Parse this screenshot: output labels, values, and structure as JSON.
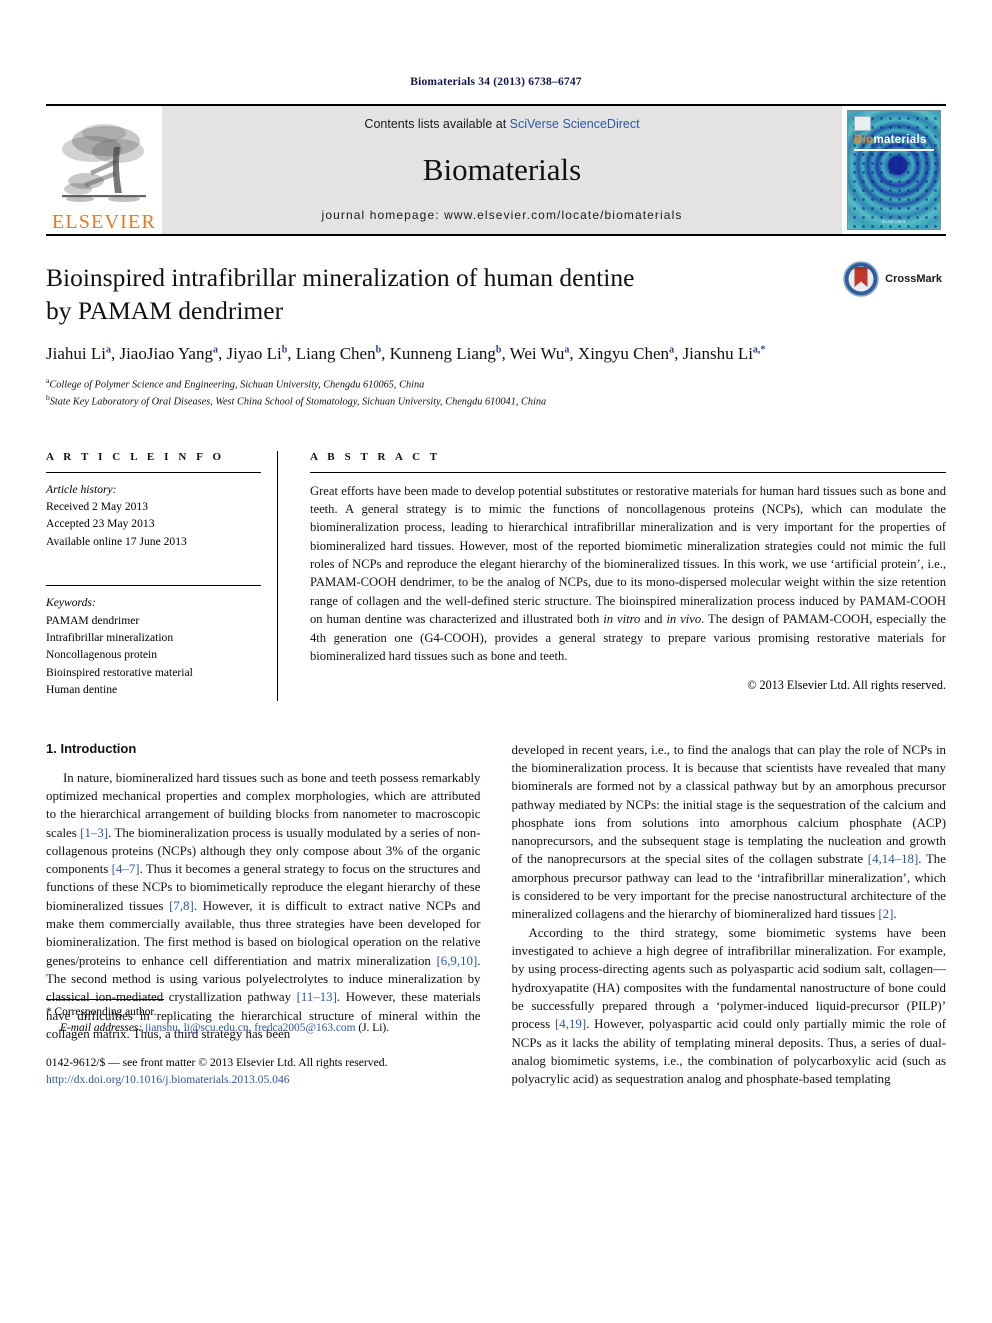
{
  "running_head": "Biomaterials 34 (2013) 6738–6747",
  "masthead": {
    "publisher_name": "ELSEVIER",
    "contents_prefix": "Contents lists available at ",
    "contents_link": "SciVerse ScienceDirect",
    "journal_name": "Biomaterials",
    "homepage": "journal homepage: www.elsevier.com/locate/biomaterials",
    "cover": {
      "title_bio": "Bio",
      "title_materials": "materials",
      "footer": "ELSEVIER"
    }
  },
  "article": {
    "title_line1": "Bioinspired intrafibrillar mineralization of human dentine",
    "title_line2": "by PAMAM dendrimer",
    "crossmark_label": "CrossMark",
    "authors": [
      {
        "name": "Jiahui Li",
        "sup": "a",
        "sep": ", "
      },
      {
        "name": "JiaoJiao Yang",
        "sup": "a",
        "sep": ", "
      },
      {
        "name": "Jiyao Li",
        "sup": "b",
        "sep": ", "
      },
      {
        "name": "Liang Chen",
        "sup": "b",
        "sep": ", "
      },
      {
        "name": "Kunneng Liang",
        "sup": "b",
        "sep": ", "
      },
      {
        "name": "Wei Wu",
        "sup": "a",
        "sep": ", "
      },
      {
        "name": "Xingyu Chen",
        "sup": "a",
        "sep": ", "
      },
      {
        "name": "Jianshu Li",
        "sup": "a,*",
        "sep": ""
      }
    ],
    "affiliations": [
      {
        "marker": "a",
        "text": "College of Polymer Science and Engineering, Sichuan University, Chengdu 610065, China"
      },
      {
        "marker": "b",
        "text": "State Key Laboratory of Oral Diseases, West China School of Stomatology, Sichuan University, Chengdu 610041, China"
      }
    ]
  },
  "article_info": {
    "heading": "A R T I C L E   I N F O",
    "history_label": "Article history:",
    "history": [
      "Received 2 May 2013",
      "Accepted 23 May 2013",
      "Available online 17 June 2013"
    ],
    "keywords_label": "Keywords:",
    "keywords": [
      "PAMAM dendrimer",
      "Intrafibrillar mineralization",
      "Noncollagenous protein",
      "Bioinspired restorative material",
      "Human dentine"
    ]
  },
  "abstract": {
    "heading": "A B S T R A C T",
    "part1": "Great efforts have been made to develop potential substitutes or restorative materials for human hard tissues such as bone and teeth. A general strategy is to mimic the functions of noncollagenous proteins (NCPs), which can modulate the biomineralization process, leading to hierarchical intrafibrillar mineralization and is very important for the properties of biomineralized hard tissues. However, most of the reported biomimetic mineralization strategies could not mimic the full roles of NCPs and reproduce the elegant hierarchy of the biomineralized tissues. In this work, we use ‘artificial protein’, i.e., PAMAM-COOH dendrimer, to be the analog of NCPs, due to its mono-dispersed molecular weight within the size retention range of collagen and the well-defined steric structure. The bioinspired mineralization process induced by PAMAM-COOH on human dentine was characterized and illustrated both ",
    "italic1": "in vitro",
    "part2": " and ",
    "italic2": "in vivo",
    "part3": ". The design of PAMAM-COOH, especially the 4th generation one (G4-COOH), provides a general strategy to prepare various promising restorative materials for biomineralized hard tissues such as bone and teeth.",
    "copyright": "© 2013 Elsevier Ltd. All rights reserved."
  },
  "introduction": {
    "heading": "1. Introduction",
    "left_p1_a": "In nature, biomineralized hard tissues such as bone and teeth possess remarkably optimized mechanical properties and complex morphologies, which are attributed to the hierarchical arrangement of building blocks from nanometer to macroscopic scales ",
    "left_ref1": "[1–3]",
    "left_p1_b": ". The biomineralization process is usually modulated by a series of non-collagenous proteins (NCPs) although they only compose about 3% of the organic components ",
    "left_ref2": "[4–7]",
    "left_p1_c": ". Thus it becomes a general strategy to focus on the structures and functions of these NCPs to biomimetically reproduce the elegant hierarchy of these biomineralized tissues ",
    "left_ref3": "[7,8]",
    "left_p1_d": ". However, it is difficult to extract native NCPs and make them commercially available, thus three strategies have been developed for biomineralization. The first method is based on biological operation on the relative genes/proteins to enhance cell differentiation and matrix mineralization ",
    "left_ref4": "[6,9,10]",
    "left_p1_e": ". The second method is using various polyelectrolytes to induce mineralization by classical ion-mediated crystallization pathway ",
    "left_ref5": "[11–13]",
    "left_p1_f": ". However, these materials have difficulties in replicating the hierarchical structure of mineral within the collagen matrix. Thus, a third strategy has been",
    "right_p1_a": "developed in recent years, i.e., to find the analogs that can play the role of NCPs in the biomineralization process. It is because that scientists have revealed that many biominerals are formed not by a classical pathway but by an amorphous precursor pathway mediated by NCPs: the initial stage is the sequestration of the calcium and phosphate ions from solutions into amorphous calcium phosphate (ACP) nanoprecursors, and the subsequent stage is templating the nucleation and growth of the nanoprecursors at the special sites of the collagen substrate ",
    "right_ref1": "[4,14–18]",
    "right_p1_b": ". The amorphous precursor pathway can lead to the ‘intrafibrillar mineralization’, which is considered to be very important for the precise nanostructural architecture of the mineralized collagens and the hierarchy of biomineralized hard tissues ",
    "right_ref2": "[2]",
    "right_p1_c": ".",
    "right_p2_a": "According to the third strategy, some biomimetic systems have been investigated to achieve a high degree of intrafibrillar mineralization. For example, by using process-directing agents such as polyaspartic acid sodium salt, collagen—hydroxyapatite (HA) composites with the fundamental nanostructure of bone could be successfully prepared through a ‘polymer-induced liquid-precursor (PILP)’ process ",
    "right_ref3": "[4,19]",
    "right_p2_b": ". However, polyaspartic acid could only partially mimic the role of NCPs as it lacks the ability of templating mineral deposits. Thus, a series of dual-analog biomimetic systems, i.e., the combination of polycarboxylic acid (such as polyacrylic acid) as sequestration analog and phosphate-based templating"
  },
  "footnotes": {
    "corresponding": "* Corresponding author.",
    "email_label": "E-mail addresses:",
    "email1": "jianshu_li@scu.edu.cn",
    "email_sep": ", ",
    "email2": "fredca2005@163.com",
    "email_tail": " (J. Li).",
    "issn_line": "0142-9612/$ — see front matter © 2013 Elsevier Ltd. All rights reserved.",
    "doi": "http://dx.doi.org/10.1016/j.biomaterials.2013.05.046"
  },
  "colors": {
    "link": "#2b57a8",
    "elsevier_orange": "#E87722",
    "band_gray": "#e3e3e3",
    "crossmark_blue": "#2c5f9e",
    "crossmark_red": "#c0392b"
  }
}
